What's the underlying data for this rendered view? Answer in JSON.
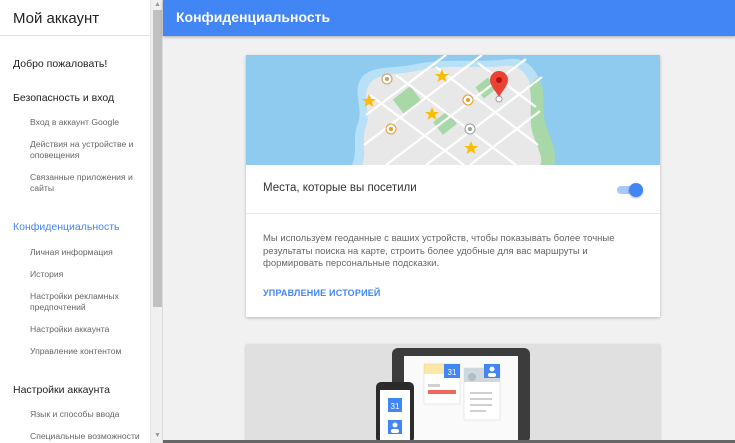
{
  "sidebar": {
    "title": "Мой аккаунт",
    "welcome": "Добро пожаловать!",
    "security": {
      "label": "Безопасность и вход",
      "items": [
        "Вход в аккаунт Google",
        "Действия на устройстве и оповещения",
        "Связанные приложения и сайты"
      ]
    },
    "privacy": {
      "label": "Конфиденциальность",
      "items": [
        "Личная информация",
        "История",
        "Настройки рекламных предпочтений",
        "Настройки аккаунта",
        "Управление контентом"
      ]
    },
    "account": {
      "label": "Настройки аккаунта",
      "items": [
        "Язык и способы ввода",
        "Специальные возможности"
      ]
    }
  },
  "header": {
    "title": "Конфиденциальность"
  },
  "card": {
    "row_label": "Места, которые вы посетили",
    "toggle_on": true,
    "description": "Мы используем геоданные с ваших устройств, чтобы показывать более точные результаты поиска на карте, строить более удобные для вас маршруты и формировать персональные подсказки.",
    "link": "УПРАВЛЕНИЕ ИСТОРИЕЙ"
  },
  "illustration": {
    "calendar_day": "31"
  },
  "colors": {
    "accent": "#4285f4",
    "map_water": "#8ecbef",
    "map_land": "#e8e8e8",
    "map_park": "#a8d8a8",
    "pin": "#ea4335",
    "star": "#fbbc05"
  }
}
